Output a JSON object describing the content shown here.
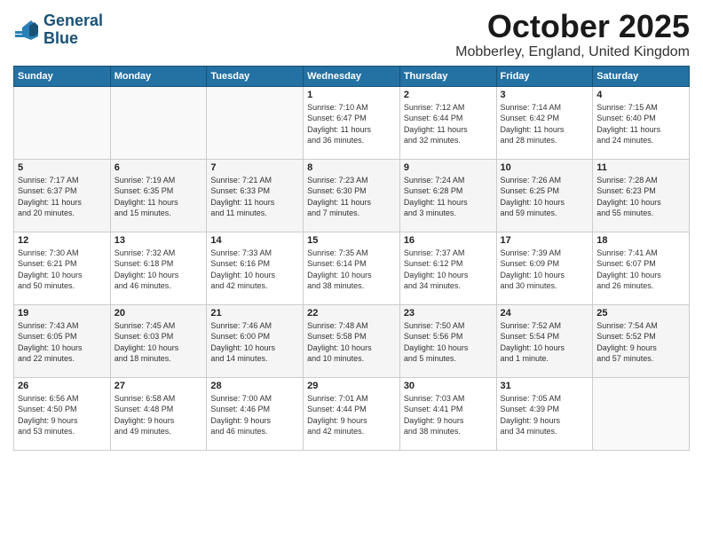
{
  "logo": {
    "text_line1": "General",
    "text_line2": "Blue"
  },
  "title": "October 2025",
  "location": "Mobberley, England, United Kingdom",
  "weekdays": [
    "Sunday",
    "Monday",
    "Tuesday",
    "Wednesday",
    "Thursday",
    "Friday",
    "Saturday"
  ],
  "rows": [
    [
      {
        "day": "",
        "info": ""
      },
      {
        "day": "",
        "info": ""
      },
      {
        "day": "",
        "info": ""
      },
      {
        "day": "1",
        "info": "Sunrise: 7:10 AM\nSunset: 6:47 PM\nDaylight: 11 hours\nand 36 minutes."
      },
      {
        "day": "2",
        "info": "Sunrise: 7:12 AM\nSunset: 6:44 PM\nDaylight: 11 hours\nand 32 minutes."
      },
      {
        "day": "3",
        "info": "Sunrise: 7:14 AM\nSunset: 6:42 PM\nDaylight: 11 hours\nand 28 minutes."
      },
      {
        "day": "4",
        "info": "Sunrise: 7:15 AM\nSunset: 6:40 PM\nDaylight: 11 hours\nand 24 minutes."
      }
    ],
    [
      {
        "day": "5",
        "info": "Sunrise: 7:17 AM\nSunset: 6:37 PM\nDaylight: 11 hours\nand 20 minutes."
      },
      {
        "day": "6",
        "info": "Sunrise: 7:19 AM\nSunset: 6:35 PM\nDaylight: 11 hours\nand 15 minutes."
      },
      {
        "day": "7",
        "info": "Sunrise: 7:21 AM\nSunset: 6:33 PM\nDaylight: 11 hours\nand 11 minutes."
      },
      {
        "day": "8",
        "info": "Sunrise: 7:23 AM\nSunset: 6:30 PM\nDaylight: 11 hours\nand 7 minutes."
      },
      {
        "day": "9",
        "info": "Sunrise: 7:24 AM\nSunset: 6:28 PM\nDaylight: 11 hours\nand 3 minutes."
      },
      {
        "day": "10",
        "info": "Sunrise: 7:26 AM\nSunset: 6:25 PM\nDaylight: 10 hours\nand 59 minutes."
      },
      {
        "day": "11",
        "info": "Sunrise: 7:28 AM\nSunset: 6:23 PM\nDaylight: 10 hours\nand 55 minutes."
      }
    ],
    [
      {
        "day": "12",
        "info": "Sunrise: 7:30 AM\nSunset: 6:21 PM\nDaylight: 10 hours\nand 50 minutes."
      },
      {
        "day": "13",
        "info": "Sunrise: 7:32 AM\nSunset: 6:18 PM\nDaylight: 10 hours\nand 46 minutes."
      },
      {
        "day": "14",
        "info": "Sunrise: 7:33 AM\nSunset: 6:16 PM\nDaylight: 10 hours\nand 42 minutes."
      },
      {
        "day": "15",
        "info": "Sunrise: 7:35 AM\nSunset: 6:14 PM\nDaylight: 10 hours\nand 38 minutes."
      },
      {
        "day": "16",
        "info": "Sunrise: 7:37 AM\nSunset: 6:12 PM\nDaylight: 10 hours\nand 34 minutes."
      },
      {
        "day": "17",
        "info": "Sunrise: 7:39 AM\nSunset: 6:09 PM\nDaylight: 10 hours\nand 30 minutes."
      },
      {
        "day": "18",
        "info": "Sunrise: 7:41 AM\nSunset: 6:07 PM\nDaylight: 10 hours\nand 26 minutes."
      }
    ],
    [
      {
        "day": "19",
        "info": "Sunrise: 7:43 AM\nSunset: 6:05 PM\nDaylight: 10 hours\nand 22 minutes."
      },
      {
        "day": "20",
        "info": "Sunrise: 7:45 AM\nSunset: 6:03 PM\nDaylight: 10 hours\nand 18 minutes."
      },
      {
        "day": "21",
        "info": "Sunrise: 7:46 AM\nSunset: 6:00 PM\nDaylight: 10 hours\nand 14 minutes."
      },
      {
        "day": "22",
        "info": "Sunrise: 7:48 AM\nSunset: 5:58 PM\nDaylight: 10 hours\nand 10 minutes."
      },
      {
        "day": "23",
        "info": "Sunrise: 7:50 AM\nSunset: 5:56 PM\nDaylight: 10 hours\nand 5 minutes."
      },
      {
        "day": "24",
        "info": "Sunrise: 7:52 AM\nSunset: 5:54 PM\nDaylight: 10 hours\nand 1 minute."
      },
      {
        "day": "25",
        "info": "Sunrise: 7:54 AM\nSunset: 5:52 PM\nDaylight: 9 hours\nand 57 minutes."
      }
    ],
    [
      {
        "day": "26",
        "info": "Sunrise: 6:56 AM\nSunset: 4:50 PM\nDaylight: 9 hours\nand 53 minutes."
      },
      {
        "day": "27",
        "info": "Sunrise: 6:58 AM\nSunset: 4:48 PM\nDaylight: 9 hours\nand 49 minutes."
      },
      {
        "day": "28",
        "info": "Sunrise: 7:00 AM\nSunset: 4:46 PM\nDaylight: 9 hours\nand 46 minutes."
      },
      {
        "day": "29",
        "info": "Sunrise: 7:01 AM\nSunset: 4:44 PM\nDaylight: 9 hours\nand 42 minutes."
      },
      {
        "day": "30",
        "info": "Sunrise: 7:03 AM\nSunset: 4:41 PM\nDaylight: 9 hours\nand 38 minutes."
      },
      {
        "day": "31",
        "info": "Sunrise: 7:05 AM\nSunset: 4:39 PM\nDaylight: 9 hours\nand 34 minutes."
      },
      {
        "day": "",
        "info": ""
      }
    ]
  ]
}
